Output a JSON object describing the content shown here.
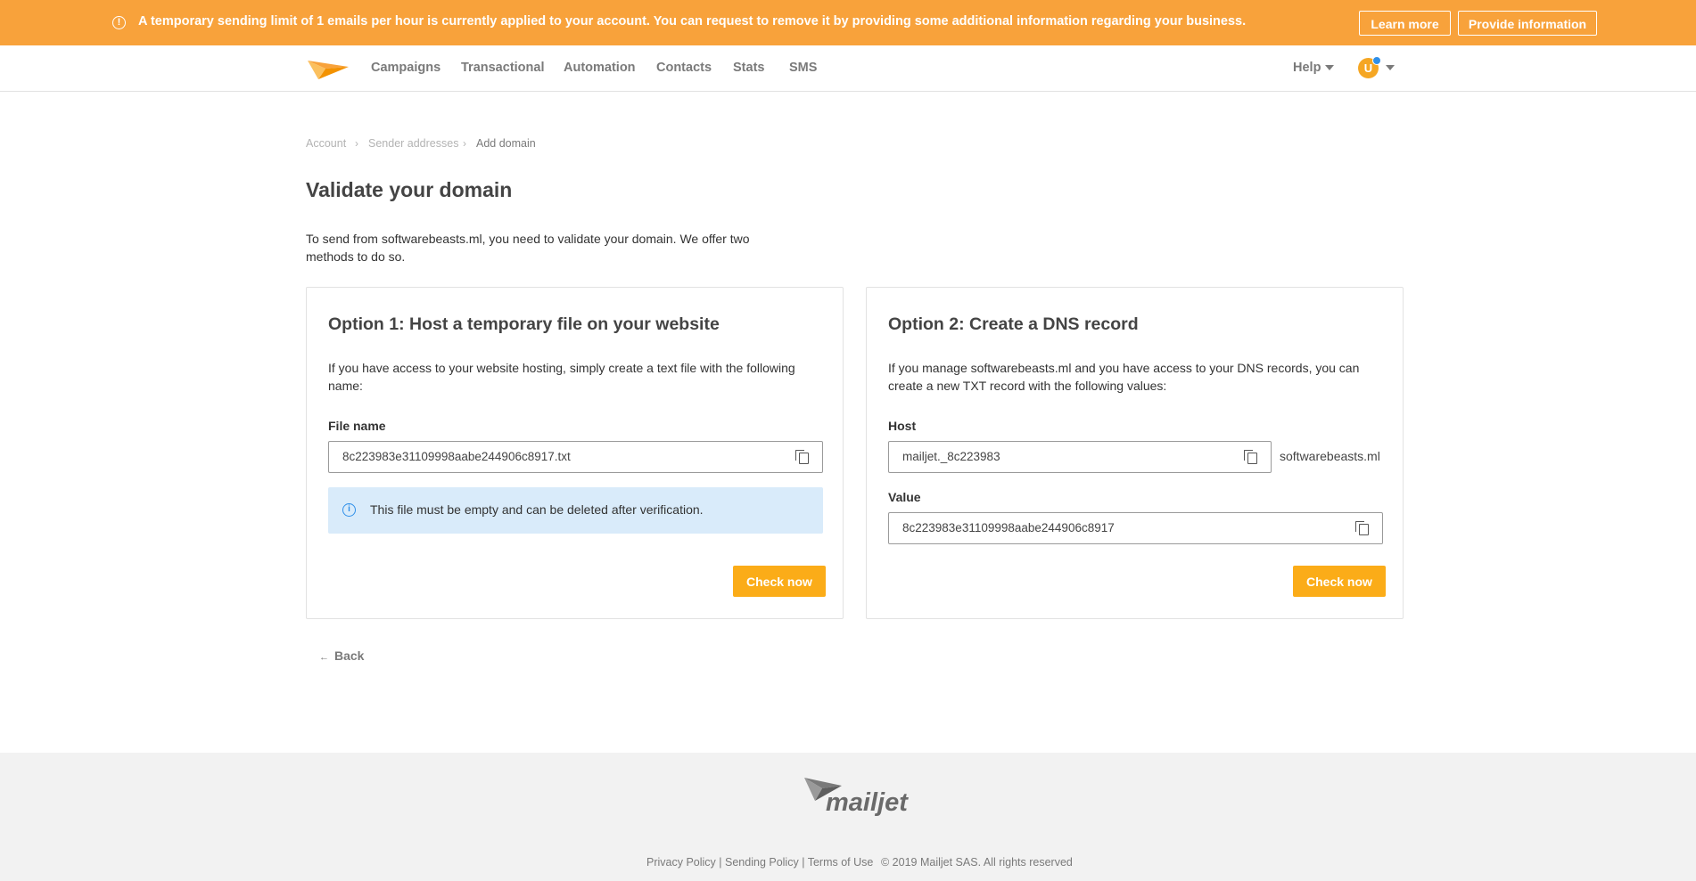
{
  "alert": {
    "message": "A temporary sending limit of 1 emails per hour is currently applied to your account. You can request to remove it by providing some additional information regarding your business.",
    "learn_more": "Learn more",
    "provide_info": "Provide information",
    "warning_glyph": "!"
  },
  "nav": {
    "items": [
      "Campaigns",
      "Transactional",
      "Automation",
      "Contacts",
      "Stats",
      "SMS"
    ],
    "help": "Help",
    "avatar_initial": "U",
    "brand_color": "#f8a23b"
  },
  "breadcrumb": [
    "Account",
    "Sender addresses",
    "Add domain"
  ],
  "page": {
    "title": "Validate your domain",
    "intro": "To send from softwarebeasts.ml, you need to validate your domain. We offer two methods to do so."
  },
  "option1": {
    "title": "Option 1: Host a temporary file on your website",
    "description": "If you have access to your website hosting, simply create a text file with the following name:",
    "file_label": "File name",
    "file_value": "8c223983e31109998aabe244906c8917.txt",
    "info_text": "This file must be empty and can be deleted after verification.",
    "check_button": "Check now"
  },
  "option2": {
    "title": "Option 2: Create a DNS record",
    "description": "If you manage softwarebeasts.ml and you have access to your DNS records, you can create a new TXT record with the following values:",
    "host_label": "Host",
    "host_value": "mailjet._8c223983",
    "host_suffix": "softwarebeasts.ml",
    "value_label": "Value",
    "value_value": "8c223983e31109998aabe244906c8917",
    "check_button": "Check now"
  },
  "back_label": "Back",
  "back_arrow": "←",
  "footer": {
    "privacy": "Privacy Policy",
    "sending": "Sending Policy",
    "terms": "Terms of Use",
    "separator": "|",
    "copyright": "© 2019 Mailjet SAS. All rights reserved",
    "logo_text": "mailjet"
  },
  "accent_button_color": "#fbac18"
}
